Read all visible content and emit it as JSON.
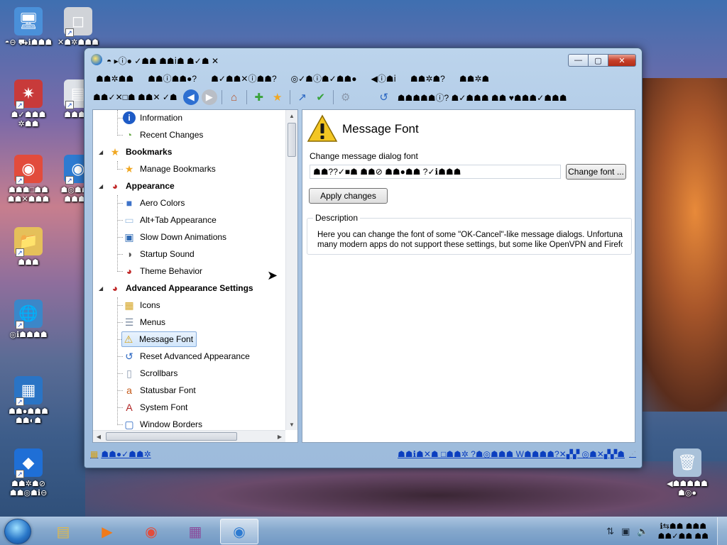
{
  "desktop": {
    "icons": [
      {
        "name": "computer",
        "label": "◓⊖ ⛟ℹ☗☗☗",
        "glyph": "🖥",
        "color": "#4a90d9"
      },
      {
        "name": "roblox",
        "label": "✕☗✲☗☗☗",
        "glyph": "◻",
        "color": "#d0d3d8"
      },
      {
        "name": "app-red",
        "label": "☗✓☗☗☗ ✲☗☗",
        "glyph": "✷",
        "color": "#c83a3a"
      },
      {
        "name": "app-doc",
        "label": "☗☗☗☗",
        "glyph": "▤",
        "color": "#dfe3e8"
      },
      {
        "name": "chrome",
        "label": "☗☗☗□☗☗ ☗☗✕☗☗☗",
        "glyph": "◉",
        "color": "#e24c3c"
      },
      {
        "name": "firefox",
        "label": "☗◎☗☗☗ ☗☗☗☗",
        "glyph": "◉",
        "color": "#2e7bd1"
      },
      {
        "name": "user-folder",
        "label": "☗☗☗",
        "glyph": "📁",
        "color": "#e5c05a"
      },
      {
        "name": "network",
        "label": "◎ℹ☗☗☗☗",
        "glyph": "🌐",
        "color": "#3b87c9"
      },
      {
        "name": "control-panel",
        "label": "☗☗●☗☗☗ ☗☗◐☗",
        "glyph": "▦",
        "color": "#2a74c5"
      },
      {
        "name": "roblox-studio",
        "label": "☗☗✲☗⊘ ☗☗◎☗ℹ⊖",
        "glyph": "◆",
        "color": "#1f6fd6"
      },
      {
        "name": "recycle-bin",
        "label": "◀☗☗☗☗☗ ☗◎●",
        "glyph": "🗑",
        "color": "#a9c1d9"
      }
    ]
  },
  "window": {
    "title": "◓ ▸ⓘ● ✓☗☗ ☗☗ⅰ☗ ☗✓☗ ✕",
    "buttons": {
      "minimize": "—",
      "maximize": "▢",
      "close": "✕"
    },
    "menu": [
      "☗☗✲☗☗",
      "☗☗ⓘ☗☗●?",
      "☗✓☗☗✕ⓘ☗☗?",
      "◎✓☗ⓘ☗✓☗☗●",
      "◀ⓘ☗ⅰ",
      "☗☗✲☗?",
      "☗☗✲☗"
    ],
    "toolbar": {
      "address": "☗☗✓✕□☗ ☗☗✕ ✓☗",
      "actions_label": "☗☗☗☗☗ⓘ?  ☗✓☗☗☗ ☗☗ ♥☗☗☗✓☗☗☗"
    },
    "tree": {
      "items": [
        {
          "label": "Information",
          "icon": "info-icon",
          "glyph": "i",
          "color": "#1e5bc6",
          "level": 1
        },
        {
          "label": "Recent Changes",
          "icon": "recent-changes-icon",
          "glyph": "◔",
          "color": "#6aaa4a",
          "level": 1
        },
        {
          "label": "Bookmarks",
          "icon": "star-icon",
          "glyph": "★",
          "color": "#f0a722",
          "level": 0
        },
        {
          "label": "Manage Bookmarks",
          "icon": "manage-bookmarks-icon",
          "glyph": "★",
          "color": "#f0a722",
          "level": 1
        },
        {
          "label": "Appearance",
          "icon": "appearance-icon",
          "glyph": "◕",
          "color": "#c22c2c",
          "level": 0
        },
        {
          "label": "Aero Colors",
          "icon": "aero-colors-icon",
          "glyph": "■",
          "color": "#3e73c9",
          "level": 1
        },
        {
          "label": "Alt+Tab Appearance",
          "icon": "alt-tab-icon",
          "glyph": "▭",
          "color": "#9bbde0",
          "level": 1
        },
        {
          "label": "Slow Down Animations",
          "icon": "animations-icon",
          "glyph": "▣",
          "color": "#2f6ab4",
          "level": 1
        },
        {
          "label": "Startup Sound",
          "icon": "sound-icon",
          "glyph": "◑",
          "color": "#555555",
          "level": 1
        },
        {
          "label": "Theme Behavior",
          "icon": "theme-icon",
          "glyph": "◕",
          "color": "#c22c2c",
          "level": 1
        },
        {
          "label": "Advanced Appearance Settings",
          "icon": "advanced-appearance-icon",
          "glyph": "◕",
          "color": "#c22c2c",
          "level": 0
        },
        {
          "label": "Icons",
          "icon": "icons-icon",
          "glyph": "▦",
          "color": "#d4a21d",
          "level": 1
        },
        {
          "label": "Menus",
          "icon": "menus-icon",
          "glyph": "☰",
          "color": "#7a8aa0",
          "level": 1
        },
        {
          "label": "Message Font",
          "icon": "warning-icon",
          "glyph": "⚠",
          "color": "#d4a010",
          "level": 1,
          "selected": true
        },
        {
          "label": "Reset Advanced Appearance",
          "icon": "reset-icon",
          "glyph": "↺",
          "color": "#2a66c2",
          "level": 1
        },
        {
          "label": "Scrollbars",
          "icon": "scrollbars-icon",
          "glyph": "▯",
          "color": "#8a9ab0",
          "level": 1
        },
        {
          "label": "Statusbar Font",
          "icon": "statusbar-font-icon",
          "glyph": "a",
          "color": "#c45a1a",
          "level": 1
        },
        {
          "label": "System Font",
          "icon": "system-font-icon",
          "glyph": "A",
          "color": "#b02222",
          "level": 1
        },
        {
          "label": "Window Borders",
          "icon": "window-borders-icon",
          "glyph": "▢",
          "color": "#2a66c2",
          "level": 1
        }
      ]
    },
    "content": {
      "title": "Message Font",
      "section_label": "Change message dialog font",
      "font_value": "☗☗??✓■☗ ☗☗⊘ ☗☗●☗☗ ?✓ℹ☗☗☗",
      "change_font_button": "Change font ...",
      "apply_button": "Apply changes",
      "description_title": "Description",
      "description_line1": "Here you can change the font of some \"OK-Cancel\"-like message dialogs. Unfortunately,",
      "description_line2": "many modern apps do not support these settings, but some like OpenVPN and Firefox sti..."
    },
    "statusbar": {
      "left": "☗☗●✓☗☗✲",
      "right": "☗☗ℹ☗✕☗ □☗☗✲ ?☗◎☗☗☗ W☗☗☗☗?✕▞▞ ◎☗✕▞▞☗"
    }
  },
  "taskbar": {
    "apps": [
      {
        "name": "explorer",
        "glyph": "▤",
        "color": "#e0b84a"
      },
      {
        "name": "media-player",
        "glyph": "▶",
        "color": "#f07a1a"
      },
      {
        "name": "chrome",
        "glyph": "◉",
        "color": "#e24c3c"
      },
      {
        "name": "winrar",
        "glyph": "▦",
        "color": "#8a4a9a"
      },
      {
        "name": "tweaker",
        "glyph": "◉",
        "color": "#2e7bd1",
        "active": true
      }
    ],
    "tray": {
      "lang": "⇅",
      "network": "▣",
      "volume": "🔈"
    },
    "clock_time": "ℹ⇆☗☗ ☗☗☗",
    "clock_date": "☗☗✓☗☗ ☗☗"
  }
}
